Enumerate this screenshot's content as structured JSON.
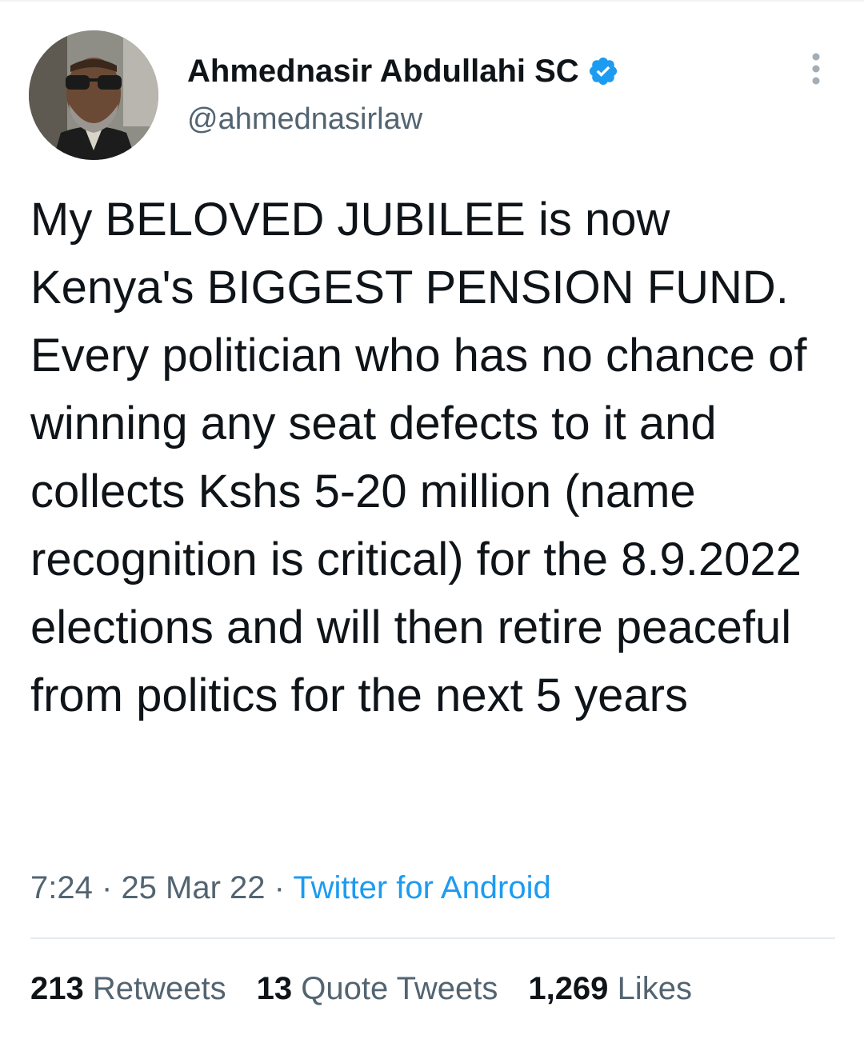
{
  "tweet": {
    "author": {
      "display_name": "Ahmednasir Abdullahi SC",
      "handle": "@ahmednasirlaw",
      "verified": true,
      "avatar": "profile-photo"
    },
    "text": "My BELOVED JUBILEE is now Kenya's BIGGEST PENSION FUND. Every politician who has no chance of winning any seat defects to it and collects Kshs 5-20 million (name recognition is critical) for the 8.9.2022 elections and will then retire peaceful from politics for the next 5 years",
    "time": "7:24",
    "separator": "·",
    "date": "25 Mar 22",
    "source": "Twitter for Android",
    "stats": [
      {
        "count": "213",
        "label": "Retweets"
      },
      {
        "count": "13",
        "label": "Quote Tweets"
      },
      {
        "count": "1,269",
        "label": "Likes"
      }
    ]
  },
  "icons": {
    "verified": "verified-badge-icon",
    "more": "more-options-icon"
  },
  "colors": {
    "text_primary": "#0f1419",
    "text_secondary": "#536471",
    "accent": "#1d9bf0",
    "divider": "#e6ecf0"
  }
}
